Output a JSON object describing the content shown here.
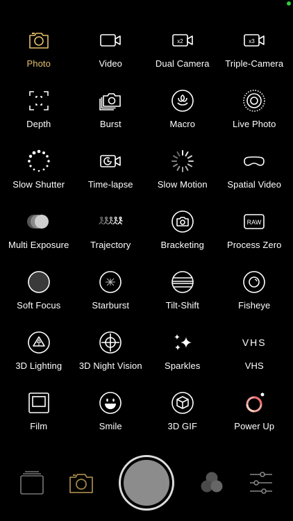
{
  "accent_color": "#e5c06b",
  "modes": [
    {
      "label": "Photo",
      "icon": "camera-icon",
      "active": true
    },
    {
      "label": "Video",
      "icon": "video-camera-icon"
    },
    {
      "label": "Dual Camera",
      "icon": "dual-camera-icon",
      "badge": "x2"
    },
    {
      "label": "Triple-Camera",
      "icon": "triple-camera-icon",
      "badge": "x3"
    },
    {
      "label": "Depth",
      "icon": "depth-icon"
    },
    {
      "label": "Burst",
      "icon": "burst-icon"
    },
    {
      "label": "Macro",
      "icon": "flower-icon"
    },
    {
      "label": "Live Photo",
      "icon": "live-photo-icon"
    },
    {
      "label": "Slow Shutter",
      "icon": "slow-shutter-icon"
    },
    {
      "label": "Time-lapse",
      "icon": "timelapse-icon"
    },
    {
      "label": "Slow Motion",
      "icon": "slow-motion-icon"
    },
    {
      "label": "Spatial Video",
      "icon": "vr-goggles-icon"
    },
    {
      "label": "Multi Exposure",
      "icon": "multi-exposure-icon"
    },
    {
      "label": "Trajectory",
      "icon": "runners-icon"
    },
    {
      "label": "Bracketing",
      "icon": "bracketing-icon"
    },
    {
      "label": "Process Zero",
      "icon": "raw-icon",
      "badge": "RAW"
    },
    {
      "label": "Soft Focus",
      "icon": "soft-focus-icon"
    },
    {
      "label": "Starburst",
      "icon": "starburst-icon"
    },
    {
      "label": "Tilt-Shift",
      "icon": "tilt-shift-icon"
    },
    {
      "label": "Fisheye",
      "icon": "fisheye-icon"
    },
    {
      "label": "3D Lighting",
      "icon": "3d-lighting-icon"
    },
    {
      "label": "3D Night Vision",
      "icon": "crosshair-icon"
    },
    {
      "label": "Sparkles",
      "icon": "sparkles-icon"
    },
    {
      "label": "VHS",
      "icon": "vhs-icon",
      "badge": "VHS"
    },
    {
      "label": "Film",
      "icon": "film-frame-icon"
    },
    {
      "label": "Smile",
      "icon": "smile-icon"
    },
    {
      "label": "3D GIF",
      "icon": "cube-icon"
    },
    {
      "label": "Power Up",
      "icon": "power-up-icon"
    }
  ],
  "bottom_bar": {
    "gallery": "gallery-stack-icon",
    "mode": "camera-icon",
    "shutter": "shutter-button",
    "filters": "filters-icon",
    "settings": "sliders-icon"
  }
}
